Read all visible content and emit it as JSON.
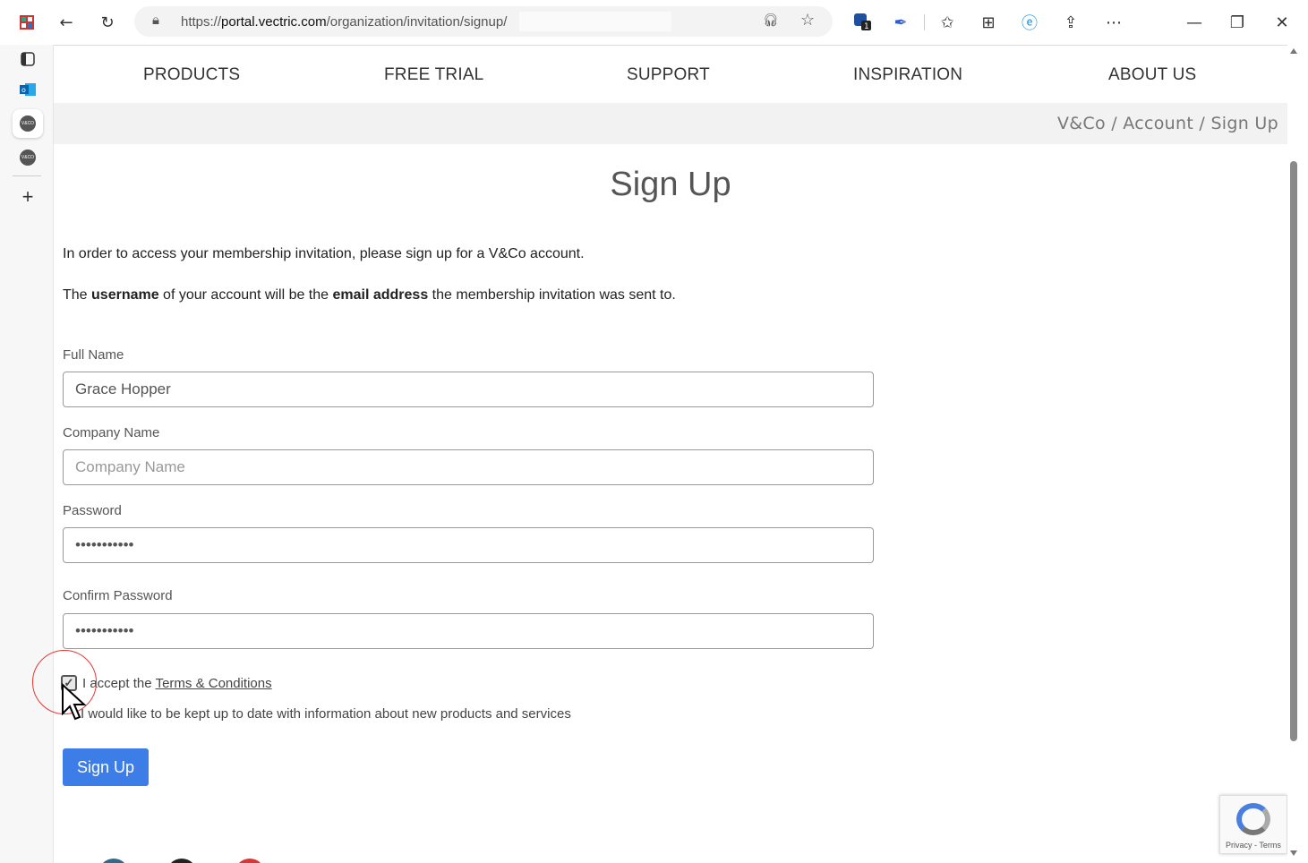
{
  "browser": {
    "url_prefix": "https://",
    "url_domain": "portal.vectric.com",
    "url_path": "/organization/invitation/signup/",
    "extension_badge": "1"
  },
  "site_nav": {
    "items": [
      "PRODUCTS",
      "FREE TRIAL",
      "SUPPORT",
      "INSPIRATION",
      "ABOUT US"
    ]
  },
  "breadcrumb": "V&Co / Account / Sign Up",
  "page": {
    "title": "Sign Up",
    "intro_line": "In order to access your membership invitation, please sign up for a V&Co account.",
    "username_prefix": "The ",
    "username_bold": "username",
    "username_middle": " of your account will be the ",
    "email_bold": "email address",
    "username_suffix": " the membership invitation was sent to."
  },
  "form": {
    "full_name_label": "Full Name",
    "full_name_value": "Grace Hopper",
    "company_label": "Company Name",
    "company_placeholder": "Company Name",
    "password_label": "Password",
    "password_value": "•••••••••••",
    "confirm_label": "Confirm Password",
    "confirm_value": "•••••••••••",
    "terms_prefix": "I accept the",
    "terms_link": "Terms & Conditions",
    "terms_checked": true,
    "newsletter_label": "I would like to be kept up to date with information about new products and services",
    "submit_label": "Sign Up"
  },
  "recaptcha": {
    "text": "Privacy - Terms"
  },
  "colors": {
    "submit_bg": "#3d7de8",
    "breadcrumb_bg": "#f2f2f2",
    "highlight": "#e53935"
  }
}
